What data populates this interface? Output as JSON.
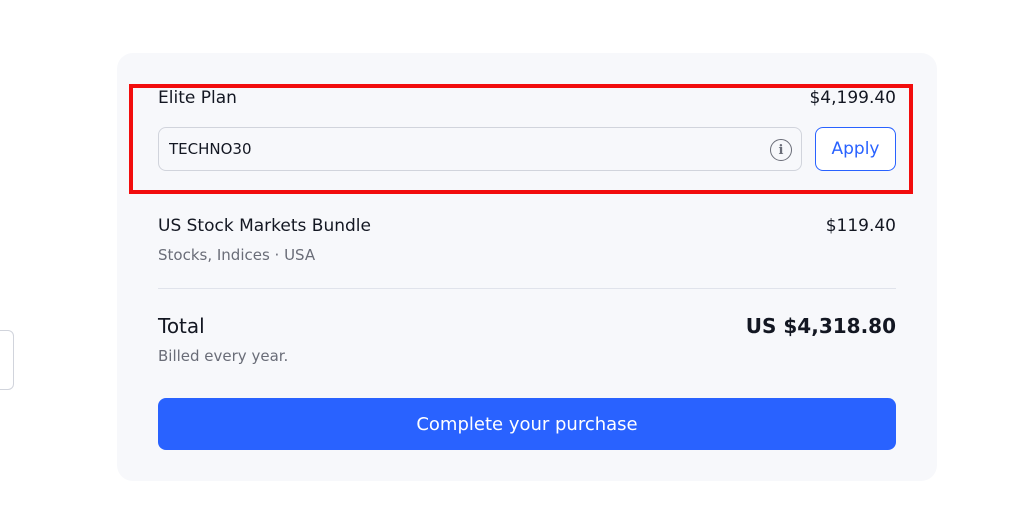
{
  "plan": {
    "name": "Elite Plan",
    "price": "$4,199.40"
  },
  "promo": {
    "code_value": "TECHNO30",
    "apply_label": "Apply",
    "info_icon": "info-circle-icon"
  },
  "bundle": {
    "name": "US Stock Markets Bundle",
    "price": "$119.40",
    "subtitle": "Stocks, Indices  ·  USA"
  },
  "total": {
    "label": "Total",
    "value": "US $4,318.80",
    "billing_note": "Billed every year."
  },
  "checkout": {
    "button_label": "Complete your purchase"
  },
  "colors": {
    "accent": "#2962ff",
    "highlight": "#f20d0d",
    "card_bg": "#f7f8fb",
    "muted_text": "#6a6d78"
  }
}
